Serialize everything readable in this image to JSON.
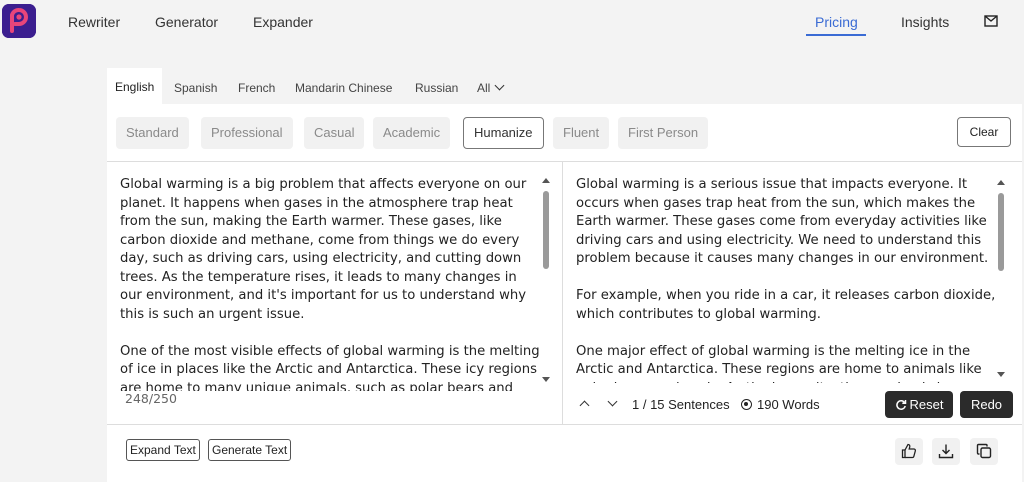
{
  "nav": {
    "links": [
      "Rewriter",
      "Generator",
      "Expander"
    ],
    "right_links": [
      "Pricing",
      "Insights"
    ],
    "active": "Pricing",
    "logo_icon": "brand-logo",
    "mail_icon": "mail-icon",
    "accent_color": "#3a6bd4"
  },
  "languages": {
    "tabs": [
      "English",
      "Spanish",
      "French",
      "Mandarin Chinese",
      "Russian"
    ],
    "more_label": "All",
    "active": "English"
  },
  "modes": {
    "items": [
      "Standard",
      "Professional",
      "Casual",
      "Academic",
      "Humanize",
      "Fluent",
      "First Person"
    ],
    "active": "Humanize",
    "clear_label": "Clear"
  },
  "input": {
    "paragraphs": [
      "Global warming is a big problem that affects everyone on our planet. It happens when gases in the atmosphere trap heat from the sun, making the Earth warmer. These gases, like carbon dioxide and methane, come from things we do every day, such as driving cars, using electricity, and cutting down trees. As the temperature rises, it leads to many changes in our environment, and it's important for us to understand why this is such an urgent issue.",
      "One of the most visible effects of global warming is the melting of ice in places like the Arctic and Antarctica. These icy regions are home to many unique animals, such as polar bears and seals. As"
    ],
    "char_count": "248/250"
  },
  "output": {
    "paragraphs": [
      "Global warming is a serious issue that impacts everyone. It occurs when gases trap heat from the sun, which makes the Earth warmer. These gases come from everyday activities like driving cars and using electricity. We need to understand this problem because it causes many changes in our environment.",
      "For example, when you ride in a car, it releases carbon dioxide, which contributes to global warming.",
      "One major effect of global warming is the melting ice in the Arctic and Antarctica. These regions are home to animals like polar bears and seals. As the ice melts, these animals lose their homes."
    ],
    "sentence_count": "1 / 15 Sentences",
    "word_count": "190 Words",
    "reset_label": "Reset",
    "redo_label": "Redo"
  },
  "footer": {
    "expand_label": "Expand Text",
    "generate_label": "Generate Text",
    "icons": [
      "thumbs-up-icon",
      "download-icon",
      "copy-icon"
    ]
  }
}
